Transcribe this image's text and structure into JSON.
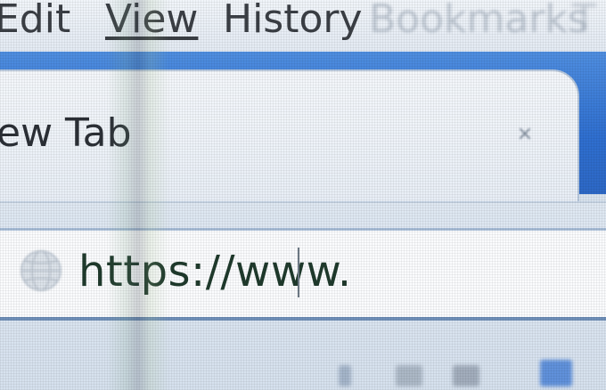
{
  "menu": {
    "edit_label": "Edit",
    "view_label": "View",
    "history_label": "History",
    "bookmarks_label": "Bookmarks",
    "extra_label": "T"
  },
  "tab": {
    "title": "ew Tab",
    "close_symbol": "×"
  },
  "address_bar": {
    "url": "https://www."
  },
  "colors": {
    "tab_strip": "#2f6fd0",
    "url_text": "#1f3a2c",
    "menu_text": "#3b3f45"
  },
  "icons": {
    "site": "globe-icon",
    "close": "close-icon"
  }
}
